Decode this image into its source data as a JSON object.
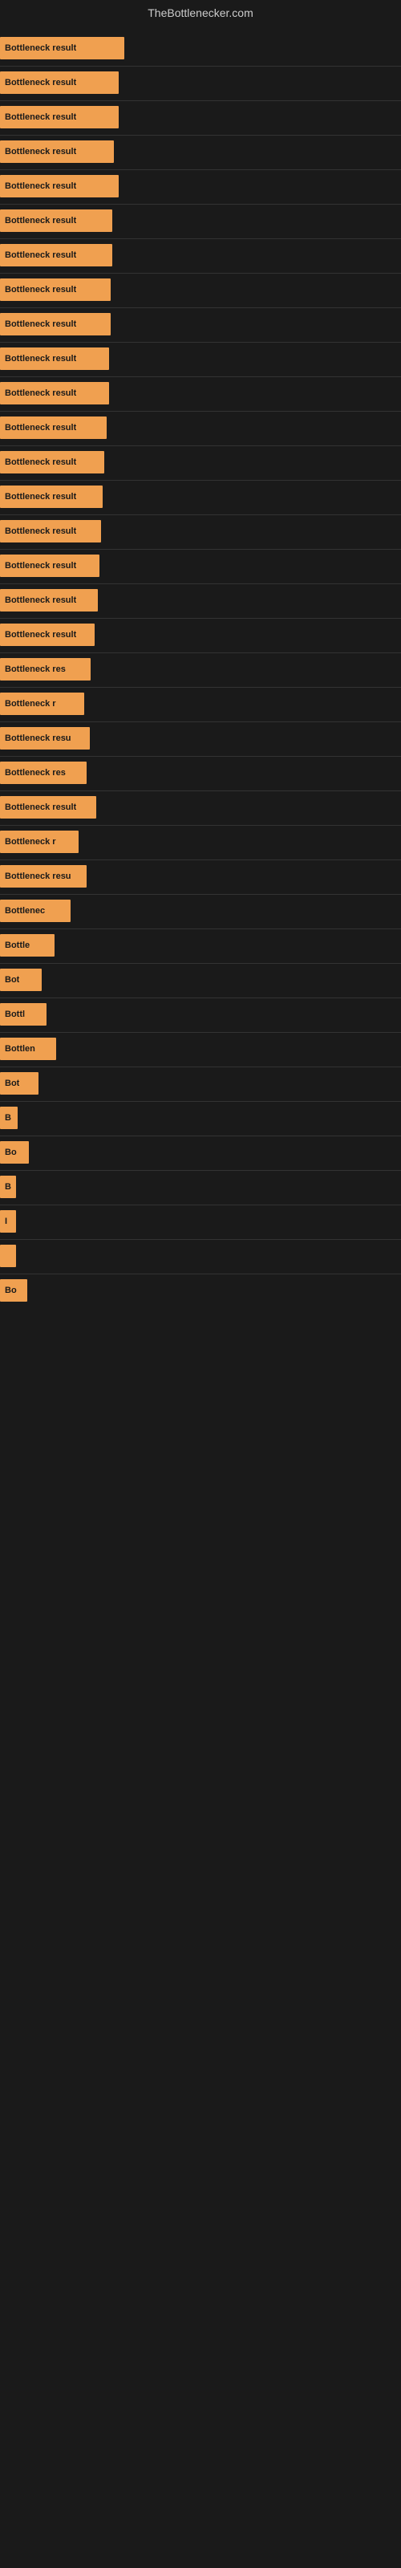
{
  "site_title": "TheBottlenecker.com",
  "bars": [
    {
      "label": "Bottleneck result",
      "width": 155
    },
    {
      "label": "Bottleneck result",
      "width": 148
    },
    {
      "label": "Bottleneck result",
      "width": 148
    },
    {
      "label": "Bottleneck result",
      "width": 142
    },
    {
      "label": "Bottleneck result",
      "width": 148
    },
    {
      "label": "Bottleneck result",
      "width": 140
    },
    {
      "label": "Bottleneck result",
      "width": 140
    },
    {
      "label": "Bottleneck result",
      "width": 138
    },
    {
      "label": "Bottleneck result",
      "width": 138
    },
    {
      "label": "Bottleneck result",
      "width": 136
    },
    {
      "label": "Bottleneck result",
      "width": 136
    },
    {
      "label": "Bottleneck result",
      "width": 133
    },
    {
      "label": "Bottleneck result",
      "width": 130
    },
    {
      "label": "Bottleneck result",
      "width": 128
    },
    {
      "label": "Bottleneck result",
      "width": 126
    },
    {
      "label": "Bottleneck result",
      "width": 124
    },
    {
      "label": "Bottleneck result",
      "width": 122
    },
    {
      "label": "Bottleneck result",
      "width": 118
    },
    {
      "label": "Bottleneck res",
      "width": 113
    },
    {
      "label": "Bottleneck r",
      "width": 105
    },
    {
      "label": "Bottleneck resu",
      "width": 112
    },
    {
      "label": "Bottleneck res",
      "width": 108
    },
    {
      "label": "Bottleneck result",
      "width": 120
    },
    {
      "label": "Bottleneck r",
      "width": 98
    },
    {
      "label": "Bottleneck resu",
      "width": 108
    },
    {
      "label": "Bottlenec",
      "width": 88
    },
    {
      "label": "Bottle",
      "width": 68
    },
    {
      "label": "Bot",
      "width": 52
    },
    {
      "label": "Bottl",
      "width": 58
    },
    {
      "label": "Bottlen",
      "width": 70
    },
    {
      "label": "Bot",
      "width": 48
    },
    {
      "label": "B",
      "width": 22
    },
    {
      "label": "Bo",
      "width": 36
    },
    {
      "label": "B",
      "width": 20
    },
    {
      "label": "I",
      "width": 14
    },
    {
      "label": "",
      "width": 10
    },
    {
      "label": "Bo",
      "width": 34
    }
  ]
}
